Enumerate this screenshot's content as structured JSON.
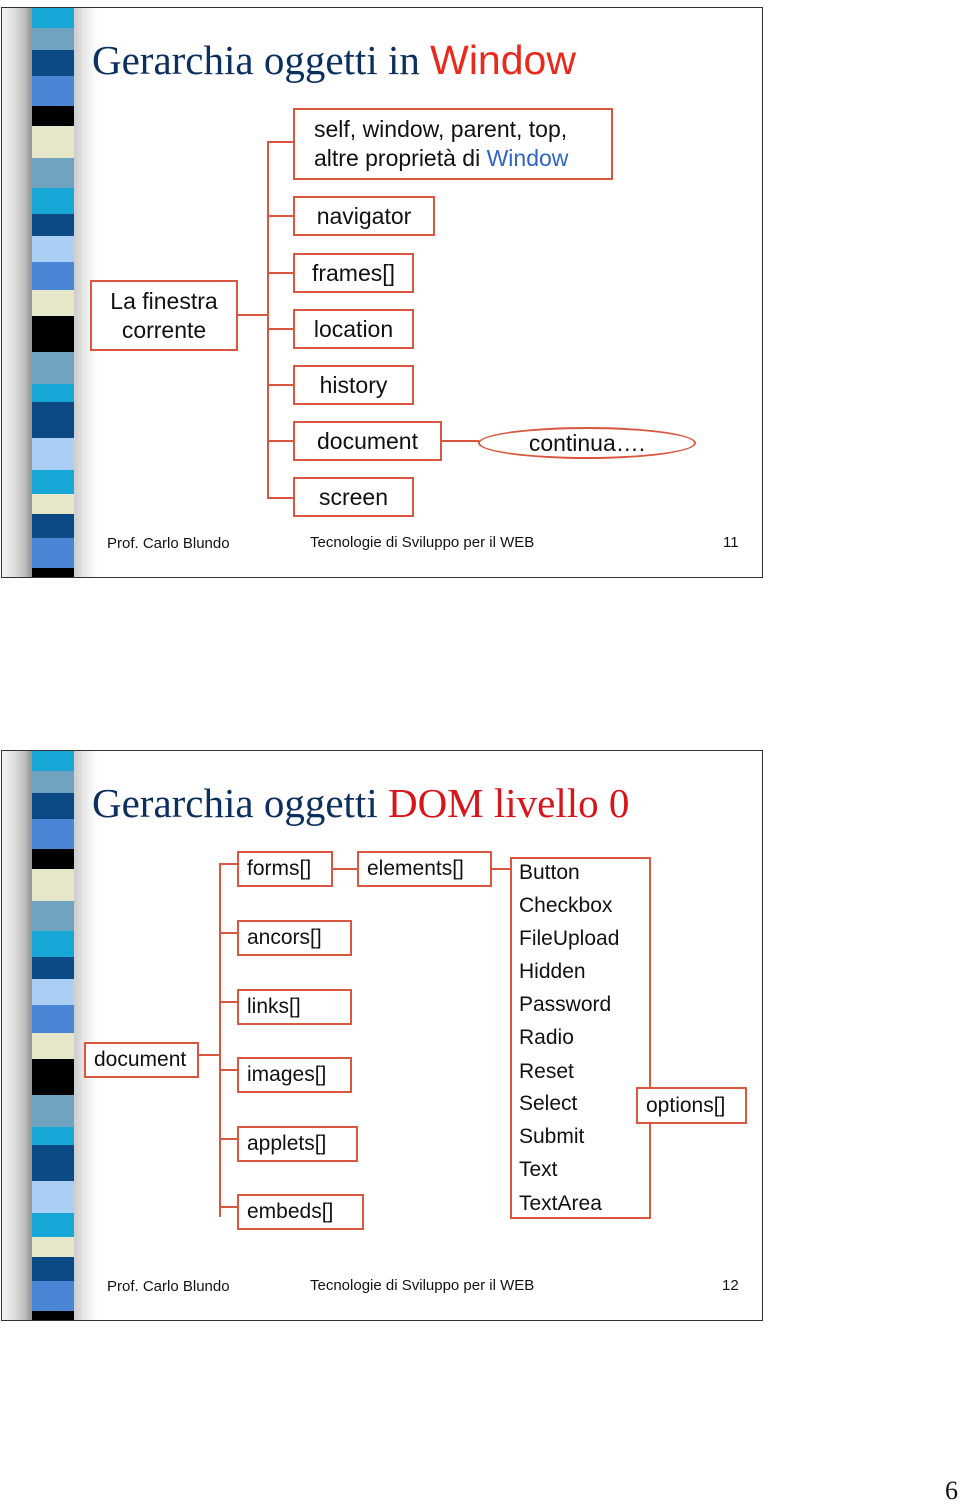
{
  "slides": [
    {
      "title_main": "Gerarchia oggetti in ",
      "title_accent": "Window",
      "root": {
        "line1": "La finestra",
        "line2": "corrente"
      },
      "children": [
        {
          "line1": "self, window, parent, top,",
          "line2_prefix": "altre proprietà di ",
          "line2_accent": "Window"
        },
        {
          "label": "navigator"
        },
        {
          "label": "frames[]"
        },
        {
          "label": "location"
        },
        {
          "label": "history"
        },
        {
          "label": "document"
        },
        {
          "label": "screen"
        }
      ],
      "continua": "continua….",
      "footer": {
        "author": "Prof. Carlo Blundo",
        "course": "Tecnologie di Sviluppo per il WEB",
        "number": "11"
      }
    },
    {
      "title_main": "Gerarchia oggetti ",
      "title_accent": "DOM livello 0",
      "root": "document",
      "children": [
        "forms[]",
        "ancors[]",
        "links[]",
        "images[]",
        "applets[]",
        "embeds[]"
      ],
      "elements": "elements[]",
      "element_types": [
        "Button",
        "Checkbox",
        "FileUpload",
        "Hidden",
        "Password",
        "Radio",
        "Reset",
        "Select",
        "Submit",
        "Text",
        "TextArea"
      ],
      "options": "options[]",
      "footer": {
        "author": "Prof. Carlo Blundo",
        "course": "Tecnologie di Sviluppo per il WEB",
        "number": "12"
      }
    }
  ],
  "page_number": "6",
  "colors": {
    "title": "#0b2f5e",
    "accent": "#e8291c",
    "box_border": "#d9573f"
  }
}
